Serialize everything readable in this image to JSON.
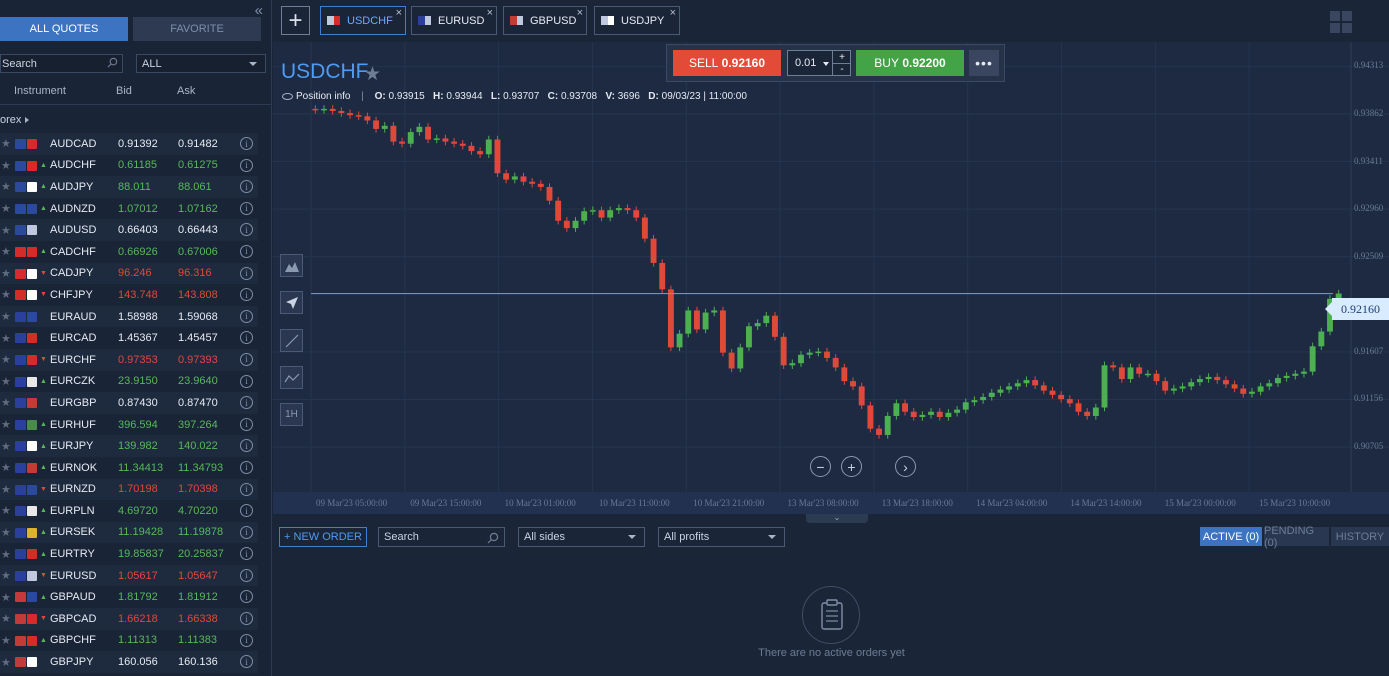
{
  "sidebar": {
    "tab_all": "ALL QUOTES",
    "tab_fav": "FAVORITE",
    "search_placeholder": "Search",
    "filter_value": "ALL",
    "col_instrument": "Instrument",
    "col_bid": "Bid",
    "col_ask": "Ask",
    "group": "orex",
    "rows": [
      {
        "sym": "AUDCAD",
        "bid": "0.91392",
        "ask": "0.91482",
        "dir": "flat",
        "f1": "#2b4a9c",
        "f2": "#d62b2b"
      },
      {
        "sym": "AUDCHF",
        "bid": "0.61185",
        "ask": "0.61275",
        "dir": "up",
        "f1": "#2b4a9c",
        "f2": "#d62b2b"
      },
      {
        "sym": "AUDJPY",
        "bid": "88.011",
        "ask": "88.061",
        "dir": "up",
        "f1": "#2b4a9c",
        "f2": "#ffffff"
      },
      {
        "sym": "AUDNZD",
        "bid": "1.07012",
        "ask": "1.07162",
        "dir": "up",
        "f1": "#2b4a9c",
        "f2": "#2b4a9c"
      },
      {
        "sym": "AUDUSD",
        "bid": "0.66403",
        "ask": "0.66443",
        "dir": "flat",
        "f1": "#2b4a9c",
        "f2": "#c0c8e0"
      },
      {
        "sym": "CADCHF",
        "bid": "0.66926",
        "ask": "0.67006",
        "dir": "up",
        "f1": "#d62b2b",
        "f2": "#d62b2b"
      },
      {
        "sym": "CADJPY",
        "bid": "96.246",
        "ask": "96.316",
        "dir": "down",
        "f1": "#d62b2b",
        "f2": "#ffffff"
      },
      {
        "sym": "CHFJPY",
        "bid": "143.748",
        "ask": "143.808",
        "dir": "down",
        "f1": "#d62b2b",
        "f2": "#ffffff"
      },
      {
        "sym": "EURAUD",
        "bid": "1.58988",
        "ask": "1.59068",
        "dir": "flat",
        "f1": "#2b3f9c",
        "f2": "#2b4a9c"
      },
      {
        "sym": "EURCAD",
        "bid": "1.45367",
        "ask": "1.45457",
        "dir": "flat",
        "f1": "#2b3f9c",
        "f2": "#d62b2b"
      },
      {
        "sym": "EURCHF",
        "bid": "0.97353",
        "ask": "0.97393",
        "dir": "down",
        "f1": "#2b3f9c",
        "f2": "#d62b2b"
      },
      {
        "sym": "EURCZK",
        "bid": "23.9150",
        "ask": "23.9640",
        "dir": "up",
        "f1": "#2b3f9c",
        "f2": "#e8e8e8"
      },
      {
        "sym": "EURGBP",
        "bid": "0.87430",
        "ask": "0.87470",
        "dir": "flat",
        "f1": "#2b3f9c",
        "f2": "#c43a3a"
      },
      {
        "sym": "EURHUF",
        "bid": "396.594",
        "ask": "397.264",
        "dir": "up",
        "f1": "#2b3f9c",
        "f2": "#4a8a4a"
      },
      {
        "sym": "EURJPY",
        "bid": "139.982",
        "ask": "140.022",
        "dir": "up",
        "f1": "#2b3f9c",
        "f2": "#ffffff"
      },
      {
        "sym": "EURNOK",
        "bid": "11.34413",
        "ask": "11.34793",
        "dir": "up",
        "f1": "#2b3f9c",
        "f2": "#c43a3a"
      },
      {
        "sym": "EURNZD",
        "bid": "1.70198",
        "ask": "1.70398",
        "dir": "down",
        "f1": "#2b3f9c",
        "f2": "#2b4a9c"
      },
      {
        "sym": "EURPLN",
        "bid": "4.69720",
        "ask": "4.70220",
        "dir": "up",
        "f1": "#2b3f9c",
        "f2": "#e8e8e8"
      },
      {
        "sym": "EURSEK",
        "bid": "11.19428",
        "ask": "11.19878",
        "dir": "up",
        "f1": "#2b3f9c",
        "f2": "#d9b52a"
      },
      {
        "sym": "EURTRY",
        "bid": "19.85837",
        "ask": "20.25837",
        "dir": "up",
        "f1": "#2b3f9c",
        "f2": "#d62b2b"
      },
      {
        "sym": "EURUSD",
        "bid": "1.05617",
        "ask": "1.05647",
        "dir": "down",
        "f1": "#2b3f9c",
        "f2": "#c0c8e0"
      },
      {
        "sym": "GBPAUD",
        "bid": "1.81792",
        "ask": "1.81912",
        "dir": "up",
        "f1": "#c43a3a",
        "f2": "#2b4a9c"
      },
      {
        "sym": "GBPCAD",
        "bid": "1.66218",
        "ask": "1.66338",
        "dir": "down",
        "f1": "#c43a3a",
        "f2": "#d62b2b"
      },
      {
        "sym": "GBPCHF",
        "bid": "1.11313",
        "ask": "1.11383",
        "dir": "up",
        "f1": "#c43a3a",
        "f2": "#d62b2b"
      },
      {
        "sym": "GBPJPY",
        "bid": "160.056",
        "ask": "160.136",
        "dir": "flat",
        "f1": "#c43a3a",
        "f2": "#ffffff"
      }
    ]
  },
  "tabs": [
    {
      "label": "USDCHF",
      "active": true,
      "f1": "#c0c8e0",
      "f2": "#d62b2b"
    },
    {
      "label": "EURUSD",
      "active": false,
      "f1": "#2b3f9c",
      "f2": "#c0c8e0"
    },
    {
      "label": "GBPUSD",
      "active": false,
      "f1": "#c43a3a",
      "f2": "#c0c8e0"
    },
    {
      "label": "USDJPY",
      "active": false,
      "f1": "#c0c8e0",
      "f2": "#ffffff"
    }
  ],
  "trade": {
    "sell_label": "SELL",
    "sell_price": "0.92160",
    "buy_label": "BUY",
    "buy_price": "0.92200",
    "quantity": "0.01",
    "more": "•••"
  },
  "instrument": {
    "title": "USDCHF",
    "position_info": "Position info",
    "o": "0.93915",
    "h": "0.93944",
    "l": "0.93707",
    "c": "0.93708",
    "v": "3696",
    "d": "09/03/23 | 11:00:00",
    "current_price": "0.92160"
  },
  "tools": {
    "timeframe": "1H"
  },
  "colors": {
    "up": "#4caf50",
    "down": "#e0493a",
    "accent": "#3c74c2",
    "price_line": "#4e9bf4"
  },
  "chart_data": {
    "type": "candlestick",
    "x_ticks": [
      "09 Mar'23 05:00:00",
      "09 Mar'23 15:00:00",
      "10 Mar'23 01:00:00",
      "10 Mar'23 11:00:00",
      "10 Mar'23 21:00:00",
      "13 Mar'23 08:00:00",
      "13 Mar'23 18:00:00",
      "14 Mar'23 04:00:00",
      "14 Mar'23 14:00:00",
      "15 Mar'23 00:00:00",
      "15 Mar'23 10:00:00"
    ],
    "y_ticks": [
      "0.94313",
      "0.93862",
      "0.93411",
      "0.92960",
      "0.92509",
      "0.91607",
      "0.91156",
      "0.90705"
    ],
    "ylim": [
      0.9045,
      0.9443
    ],
    "price_line": 0.9216,
    "closes": [
      0.939,
      0.9391,
      0.9389,
      0.9387,
      0.9385,
      0.9384,
      0.938,
      0.9372,
      0.9375,
      0.936,
      0.9358,
      0.9369,
      0.9374,
      0.9362,
      0.9363,
      0.936,
      0.9358,
      0.9356,
      0.9351,
      0.9348,
      0.9362,
      0.933,
      0.9324,
      0.9327,
      0.9322,
      0.932,
      0.9317,
      0.9304,
      0.9285,
      0.9278,
      0.9285,
      0.9294,
      0.9295,
      0.9288,
      0.9295,
      0.9297,
      0.9295,
      0.9288,
      0.9268,
      0.9245,
      0.922,
      0.9165,
      0.9178,
      0.92,
      0.9182,
      0.9198,
      0.92,
      0.916,
      0.9145,
      0.9165,
      0.9185,
      0.9188,
      0.9195,
      0.9175,
      0.9148,
      0.915,
      0.9158,
      0.916,
      0.9161,
      0.9155,
      0.9146,
      0.9133,
      0.9128,
      0.911,
      0.9088,
      0.9082,
      0.91,
      0.9112,
      0.9104,
      0.9099,
      0.9101,
      0.9104,
      0.9099,
      0.9103,
      0.9106,
      0.9113,
      0.9115,
      0.9118,
      0.9122,
      0.9125,
      0.9128,
      0.9131,
      0.9134,
      0.9129,
      0.9124,
      0.912,
      0.9116,
      0.9112,
      0.9104,
      0.91,
      0.9108,
      0.9148,
      0.9146,
      0.9135,
      0.9146,
      0.914,
      0.914,
      0.9133,
      0.9124,
      0.9126,
      0.9128,
      0.9132,
      0.9135,
      0.9137,
      0.9134,
      0.913,
      0.9126,
      0.9121,
      0.9123,
      0.9128,
      0.9131,
      0.9136,
      0.9138,
      0.914,
      0.9142,
      0.9166,
      0.918,
      0.9211,
      0.9216
    ]
  },
  "orders": {
    "new_order": "+ NEW ORDER",
    "search_placeholder": "Search",
    "sides": "All sides",
    "profits": "All profits",
    "tab_active": "ACTIVE (0)",
    "tab_pending": "PENDING (0)",
    "tab_history": "HISTORY",
    "empty_text": "There are no active orders yet"
  }
}
